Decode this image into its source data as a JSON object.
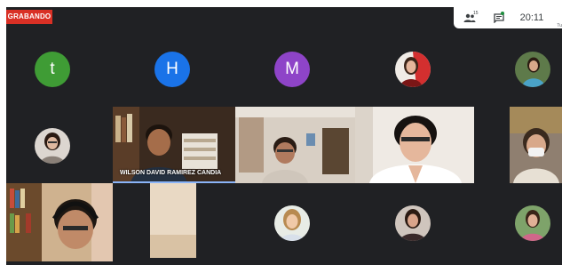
{
  "recording": {
    "label": "GRABANDO",
    "color": "#d93025"
  },
  "topbar": {
    "people_icon": "people-icon",
    "people_count": "15",
    "chat_icon": "chat-icon",
    "time": "20:11",
    "tail_text": "Tu"
  },
  "participants": [
    {
      "kind": "letter",
      "letter": "t",
      "color": "#3f9c35"
    },
    {
      "kind": "letter",
      "letter": "H",
      "color": "#1a73e8"
    },
    {
      "kind": "letter",
      "letter": "M",
      "color": "#8e44c8"
    },
    {
      "kind": "photo"
    },
    {
      "kind": "photo"
    },
    {
      "kind": "photo"
    },
    {
      "kind": "photo"
    },
    {
      "kind": "photo"
    },
    {
      "kind": "photo"
    }
  ],
  "active_tile": {
    "name": "WILSON DAVID RAMIREZ CANDIA"
  }
}
